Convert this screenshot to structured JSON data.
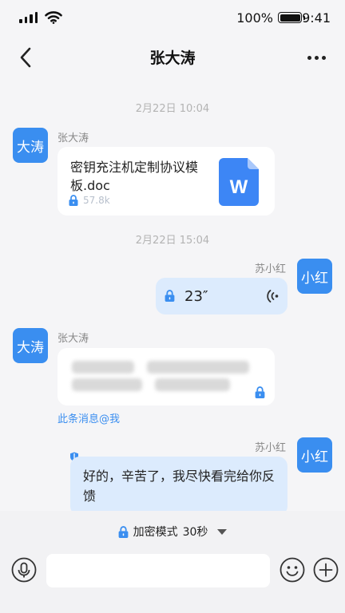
{
  "status_bar": {
    "battery_percent": "100%",
    "time": "9:41"
  },
  "nav": {
    "title": "张大涛",
    "back_icon": "chevron-left-icon",
    "more_icon": "more-dots-icon"
  },
  "messages": {
    "ts1": "2月22日 10:04",
    "m1": {
      "avatar": "大涛",
      "sender": "张大涛",
      "file_name": "密钥充注机定制协议模板.doc",
      "file_size": "57.8k",
      "file_icon_letter": "W"
    },
    "ts2": "2月22日 15:04",
    "m2": {
      "avatar": "小红",
      "sender": "苏小红",
      "voice_duration": "23″"
    },
    "m3": {
      "avatar": "大涛",
      "sender": "张大涛",
      "mention": "此条消息@我"
    },
    "m4": {
      "avatar": "小红",
      "sender": "苏小红",
      "text": "好的，辛苦了，我尽快看完给你反馈"
    }
  },
  "footer": {
    "mode_label": "加密模式",
    "timer": "30秒",
    "input_placeholder": ""
  },
  "colors": {
    "accent": "#3a8ef0",
    "bubble_self": "#dcebfd",
    "background": "#f5f5f7"
  }
}
